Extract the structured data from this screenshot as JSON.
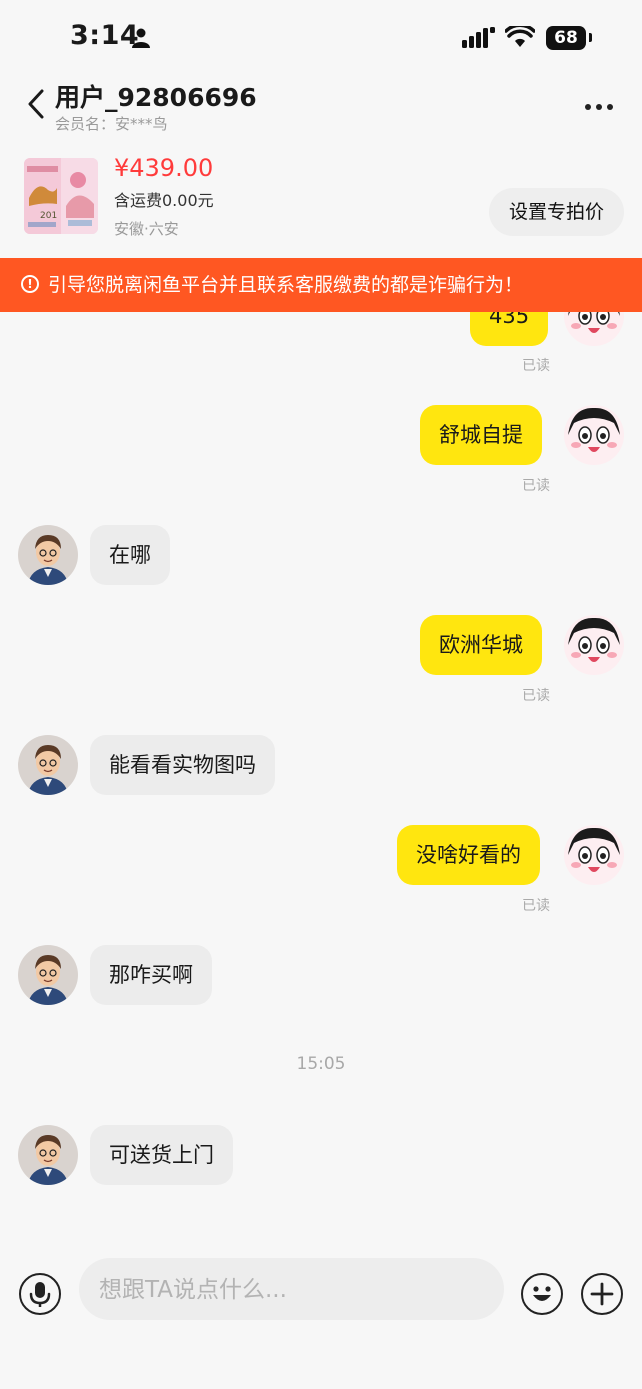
{
  "status_bar": {
    "time": "3:14",
    "battery": "68"
  },
  "header": {
    "title": "用户_92806696",
    "subtitle": "会员名：安***鸟"
  },
  "product": {
    "price": "¥439.00",
    "shipping": "含运费0.00元",
    "location": "安徽·六安",
    "set_price_label": "设置专拍价"
  },
  "warning": {
    "text": "引导您脱离闲鱼平台并且联系客服缴费的都是诈骗行为！"
  },
  "messages": [
    {
      "side": "right",
      "text": "435",
      "status": "已读"
    },
    {
      "side": "right",
      "text": "舒城自提",
      "status": "已读"
    },
    {
      "side": "left",
      "text": "在哪"
    },
    {
      "side": "right",
      "text": "欧洲华城",
      "status": "已读"
    },
    {
      "side": "left",
      "text": "能看看实物图吗"
    },
    {
      "side": "right",
      "text": "没啥好看的",
      "status": "已读"
    },
    {
      "side": "left",
      "text": "那咋买啊"
    },
    {
      "side": "left",
      "text": "可送货上门"
    }
  ],
  "time_separator": "15:05",
  "composer": {
    "placeholder": "想跟TA说点什么..."
  },
  "colors": {
    "accent_yellow": "#ffe60f",
    "warning_orange": "#ff5722",
    "price_red": "#ff3b3b"
  }
}
